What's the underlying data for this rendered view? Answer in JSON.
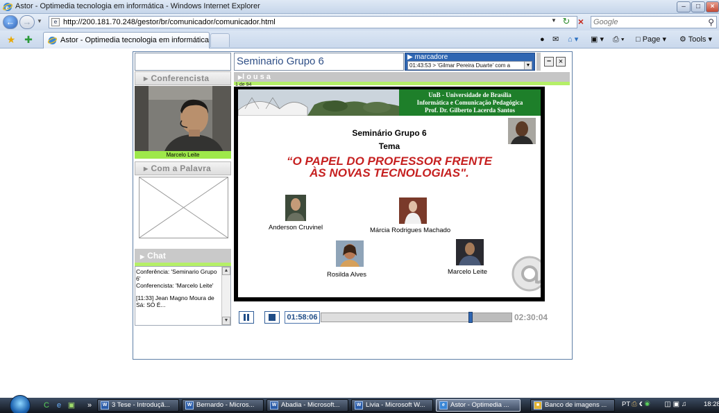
{
  "window": {
    "title": "Astor - Optimedia tecnologia em informática - Windows Internet Explorer"
  },
  "addressbar": {
    "url": "http://200.181.70.248/gestor/br/comunicador/comunicador.html",
    "search_placeholder": "Google"
  },
  "tabs": [
    {
      "label": "Astor - Optimedia tecnologia em informática"
    }
  ],
  "commandbar": {
    "page_label": "Page",
    "tools_label": "Tools"
  },
  "app": {
    "title": "Seminario Grupo 6",
    "marcadores": {
      "label": "marcadore",
      "selected": "01:43:53 > 'Gilmar Pereira Duarte' com a"
    },
    "conferencista": {
      "header": "Conferencista",
      "name": "Marcelo Leite"
    },
    "palavra": {
      "header": "Com a Palavra"
    },
    "chat": {
      "header": "Chat",
      "lines": [
        "Conferência: 'Seminario Grupo 6'",
        "Conferencista: 'Marcelo Leite'",
        "",
        "[11:33] Jean Magno Moura de Sá: SÓ É..."
      ]
    },
    "lousa": {
      "header": "lousa",
      "page_count": "1 de 94"
    },
    "slide": {
      "banner": [
        "UnB - Universidade de Brasília",
        "Informática e Comunicação Pedagógica",
        "Prof. Dr. Gilberto Lacerda Santos"
      ],
      "seminar": "Seminário Grupo 6",
      "tema": "Tema",
      "title_line1": "“O PAPEL DO PROFESSOR FRENTE",
      "title_line2": "ÀS NOVAS TECNOLOGIAS\".",
      "people": [
        {
          "name": "Anderson Cruvinel"
        },
        {
          "name": "Márcia Rodrigues Machado"
        },
        {
          "name": "Rosilda Alves"
        },
        {
          "name": "Marcelo Leite"
        }
      ]
    },
    "player": {
      "current_time": "01:58:06",
      "total_time": "02:30:04",
      "progress": 0.786
    }
  },
  "taskbar": {
    "tasks": [
      {
        "label": "3 Tese - Introduçã..."
      },
      {
        "label": "Bernardo - Micros..."
      },
      {
        "label": "Abadia - Microsoft..."
      },
      {
        "label": "Livia - Microsoft W..."
      },
      {
        "label": "Astor - Optimedia ..."
      },
      {
        "label": "Banco de imagens ..."
      }
    ],
    "language": "PT",
    "clock": "18:28",
    "chevron": "»"
  }
}
